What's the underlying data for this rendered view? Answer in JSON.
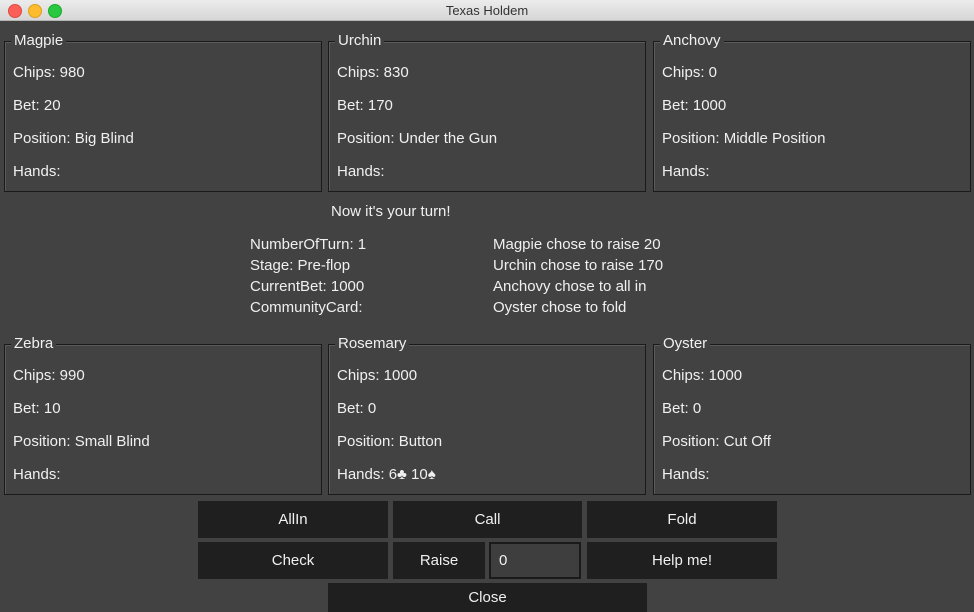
{
  "window": {
    "title": "Texas Holdem"
  },
  "players": [
    {
      "name": "Magpie",
      "chips": "Chips: 980",
      "bet": "Bet: 20",
      "position": "Position: Big Blind",
      "hands": "Hands:"
    },
    {
      "name": "Urchin",
      "chips": "Chips: 830",
      "bet": "Bet: 170",
      "position": "Position: Under the Gun",
      "hands": "Hands:"
    },
    {
      "name": "Anchovy",
      "chips": "Chips: 0",
      "bet": "Bet: 1000",
      "position": "Position: Middle Position",
      "hands": "Hands:"
    },
    {
      "name": "Zebra",
      "chips": "Chips: 990",
      "bet": "Bet: 10",
      "position": "Position: Small Blind",
      "hands": "Hands:"
    },
    {
      "name": "Rosemary",
      "chips": "Chips: 1000",
      "bet": "Bet: 0",
      "position": "Position: Button",
      "hands": "Hands: 6♣ 10♠"
    },
    {
      "name": "Oyster",
      "chips": "Chips: 1000",
      "bet": "Bet: 0",
      "position": "Position: Cut Off",
      "hands": "Hands:"
    }
  ],
  "status": {
    "turn_message": "Now it's your turn!",
    "number_of_turn": "NumberOfTurn: 1",
    "stage": "Stage: Pre-flop",
    "current_bet": "CurrentBet: 1000",
    "community_card": "CommunityCard:"
  },
  "log": [
    "Magpie chose to raise 20",
    "Urchin chose to raise 170",
    "Anchovy chose to all in",
    "Oyster chose to fold"
  ],
  "actions": {
    "all_in": "AllIn",
    "call": "Call",
    "fold": "Fold",
    "check": "Check",
    "raise": "Raise",
    "raise_amount": "0",
    "help": "Help me!",
    "close": "Close"
  }
}
